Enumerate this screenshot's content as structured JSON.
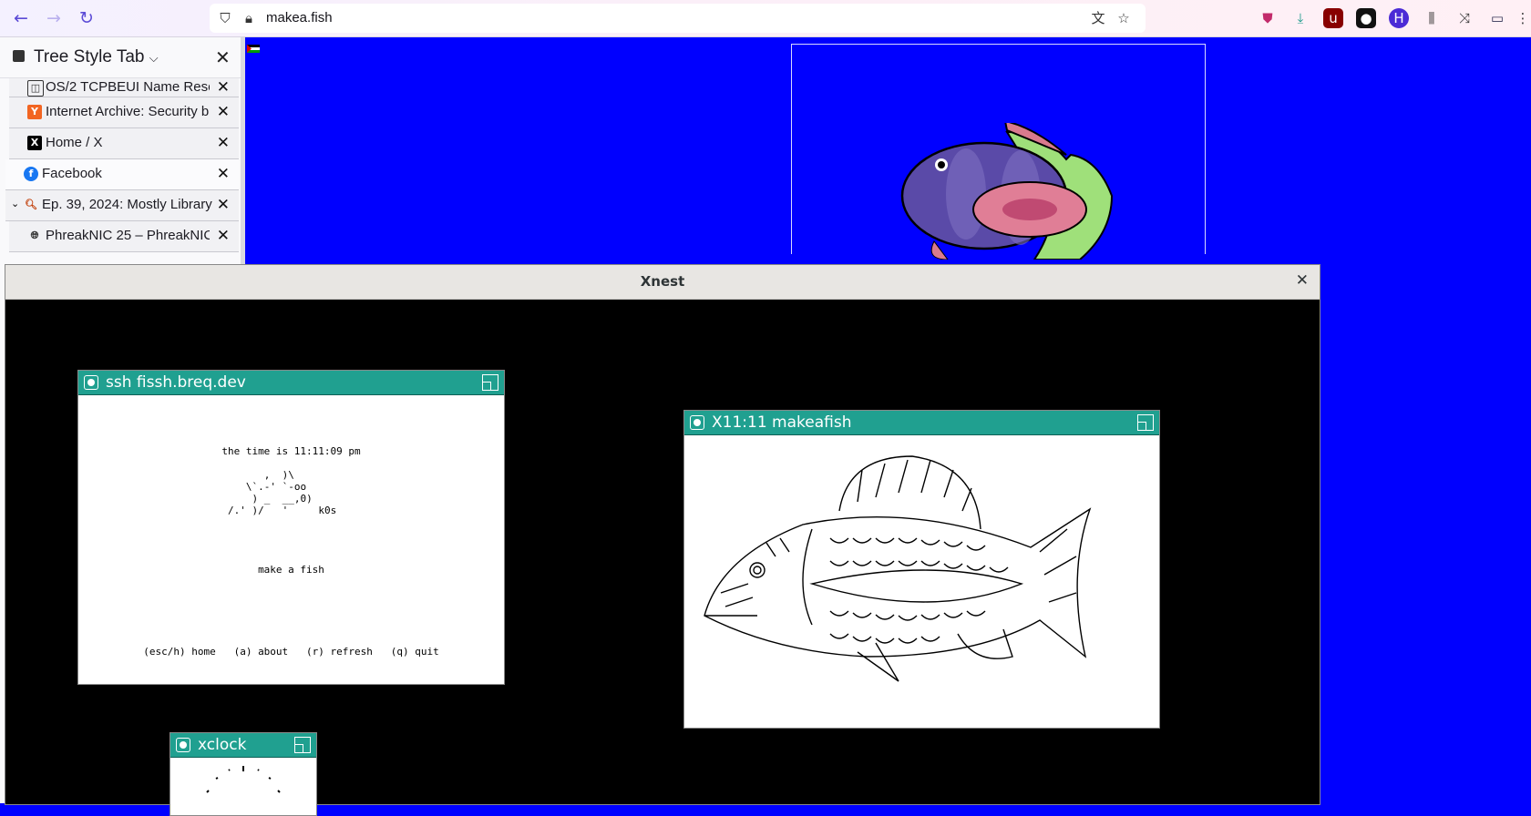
{
  "browser": {
    "url": "makea.fish"
  },
  "sidebar": {
    "title": "Tree Style Tab",
    "tabs": [
      {
        "label": "OS/2 TCPBEUI Name Resolu"
      },
      {
        "label": "Internet Archive: Security bre"
      },
      {
        "label": "Home / X"
      },
      {
        "label": "Facebook"
      },
      {
        "label": "Ep. 39, 2024: Mostly Library T"
      },
      {
        "label": "PhreakNIC 25 – PhreakNIC 2"
      }
    ]
  },
  "xnest": {
    "title": "Xnest",
    "ssh_window": {
      "title": "ssh fissh.breq.dev",
      "time_line": "the time is 11:11:09 pm",
      "ascii_art": "      ,  )\\\n   \\`.-' `-oo\n    ) _  __,0)\n/.' )/   '     k0s",
      "tagline": "make a fish",
      "menu": "(esc/h) home   (a) about   (r) refresh   (q) quit"
    },
    "fish_window": {
      "title": "X11:11 makeafish"
    },
    "clock_window": {
      "title": "xclock"
    }
  }
}
